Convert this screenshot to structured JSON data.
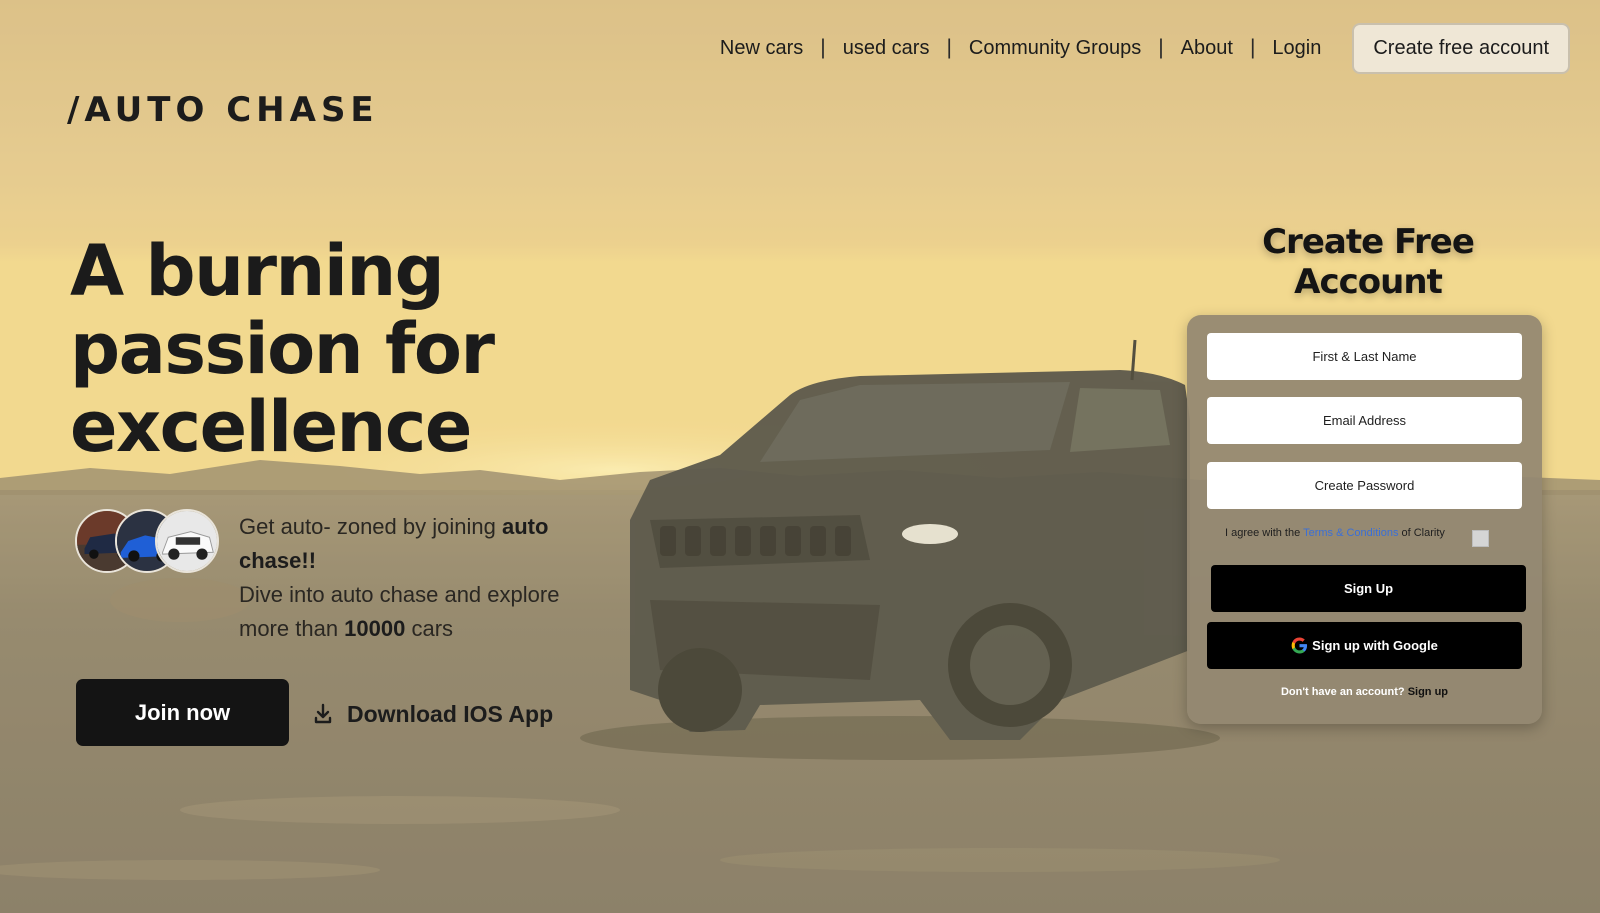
{
  "nav": {
    "items": [
      "New cars",
      "used cars",
      "Community Groups",
      "About",
      "Login"
    ],
    "separator": "|",
    "cta_label": "Create free account"
  },
  "brand": {
    "logo": "/AUTO CHASE"
  },
  "hero": {
    "headline": "A burning passion for excellence",
    "tagline": {
      "part1": "Get auto- zoned by joining ",
      "bold1": "auto chase!!",
      "part2": "Dive into auto chase and explore more than ",
      "bold2": "10000",
      "part3": " cars"
    },
    "join_label": "Join now",
    "download_label": "Download IOS App",
    "avatars": [
      "red-suv-avatar",
      "blue-sedan-avatar",
      "white-suv-avatar"
    ]
  },
  "signup": {
    "title": "Create Free Account",
    "name_placeholder": "First & Last Name",
    "email_placeholder": "Email Address",
    "password_placeholder": "Create Password",
    "agree_prefix": "I agree with the ",
    "terms_link": "Terms & Conditions",
    "agree_suffix": " of Clarity",
    "signup_button": "Sign Up",
    "google_button": "Sign up with Google",
    "no_account_text": "Don't have an account?",
    "signup_link": "Sign up",
    "checkbox_checked": false
  },
  "colors": {
    "sky": "#e6c98a",
    "ground": "#7a715f",
    "card": "#948872",
    "dark_button": "#141414",
    "link_blue": "#3b6fd6"
  }
}
